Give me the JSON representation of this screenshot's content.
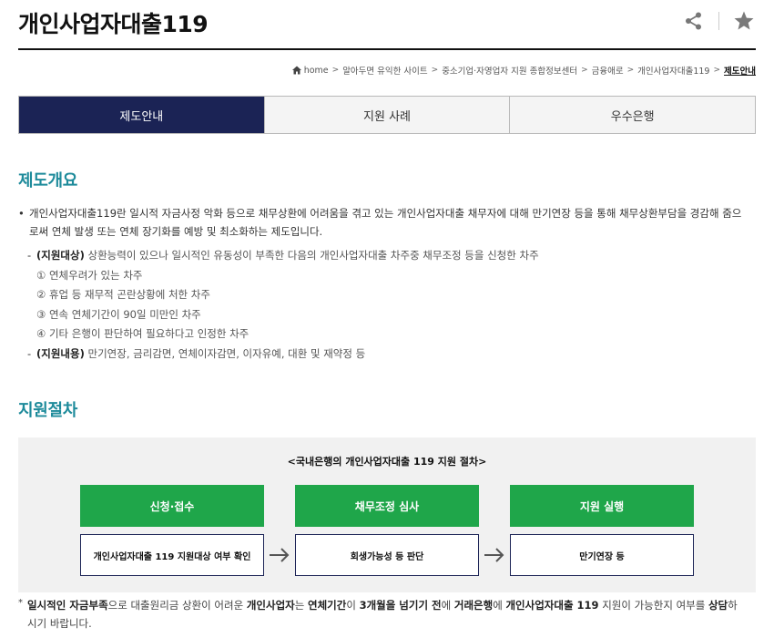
{
  "header": {
    "title": "개인사업자대출119",
    "share_icon": "share-icon",
    "favorite_icon": "star-icon"
  },
  "breadcrumb": [
    {
      "label": "home",
      "icon": "home-icon"
    },
    {
      "label": "알아두면 유익한 사이트"
    },
    {
      "label": "중소기업·자영업자 지원 종합정보센터"
    },
    {
      "label": "금융애로"
    },
    {
      "label": "개인사업자대출119"
    },
    {
      "label": "제도안내",
      "current": true
    }
  ],
  "tabs": [
    {
      "label": "제도안내",
      "active": true
    },
    {
      "label": "지원 사례",
      "active": false
    },
    {
      "label": "우수은행",
      "active": false
    }
  ],
  "overview": {
    "title": "제도개요",
    "bullet": "•",
    "description": "개인사업자대출119란 일시적 자금사정 악화 등으로 채무상환에 어려움을 겪고 있는 개인사업자대출 채무자에 대해 만기연장 등을 통해 채무상환부담을 경감해 줌으로써 연체 발생 또는 연체 장기화를 예방 및 최소화하는 제도입니다.",
    "target": {
      "dash": "-",
      "label": "(지원대상)",
      "text": " 상환능력이 있으나 일시적인 유동성이 부족한 다음의 개인사업자대출 차주중 채무조정 등을 신청한 차주",
      "items": [
        "① 연체우려가 있는 차주",
        "② 휴업 등 재무적 곤란상황에 처한 차주",
        "③ 연속 연체기간이 90일 미만인 차주",
        "④ 기타 은행이 판단하여 필요하다고 인정한 차주"
      ]
    },
    "content": {
      "dash": "-",
      "label": "(지원내용)",
      "text": " 만기연장, 금리감면, 연체이자감면, 이자유예, 대환 및 재약정 등"
    }
  },
  "procedure": {
    "title": "지원절차",
    "box_title": "<국내은행의 개인사업자대출 119 지원 절차>",
    "steps": [
      {
        "head": "신청·접수",
        "body": "개인사업자대출 119 지원대상 여부 확인"
      },
      {
        "head": "채무조정 심사",
        "body": "회생가능성 등 판단"
      },
      {
        "head": "지원 실행",
        "body": "만기연장 등"
      }
    ],
    "arrow_icon": "arrow-right-icon"
  },
  "note": {
    "mark": "*",
    "parts": [
      {
        "t": "일시적인 자금부족",
        "b": true
      },
      {
        "t": "으로 대출원리금 상환이 어려운 ",
        "b": false
      },
      {
        "t": "개인사업자",
        "b": true
      },
      {
        "t": "는 ",
        "b": false
      },
      {
        "t": "연체기간",
        "b": true
      },
      {
        "t": "이 ",
        "b": false
      },
      {
        "t": "3개월을 넘기기 전",
        "b": true
      },
      {
        "t": "에 ",
        "b": false
      },
      {
        "t": "거래은행",
        "b": true
      },
      {
        "t": "에 ",
        "b": false
      },
      {
        "t": "개인사업자대출 119",
        "b": true
      },
      {
        "t": " 지원이 가능한지 여부를 ",
        "b": false
      },
      {
        "t": "상담",
        "b": true
      },
      {
        "t": "하시기 바랍니다.",
        "b": false
      }
    ]
  },
  "colors": {
    "title_accent": "#1e8b9b",
    "tab_active": "#1b2355",
    "step_green": "#1fa64a"
  }
}
